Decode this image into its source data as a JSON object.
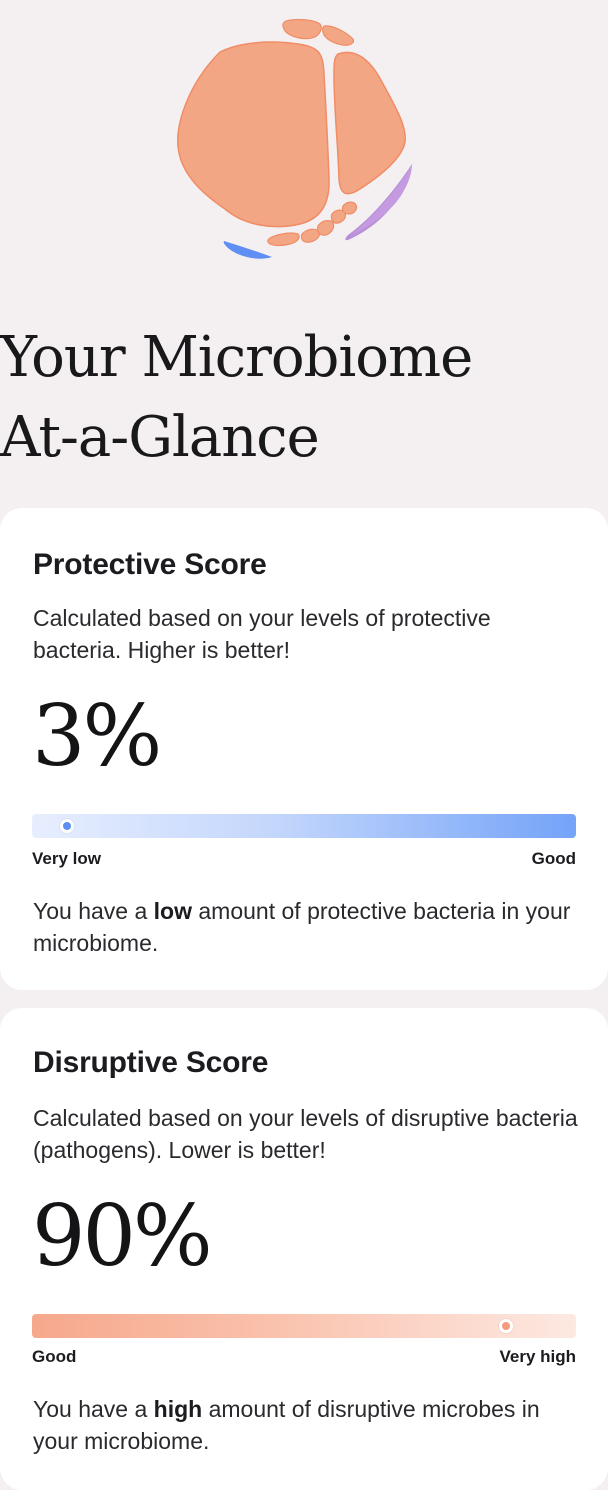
{
  "header": {
    "title_line1": "Your Microbiome",
    "title_line2": "At-a-Glance"
  },
  "illustration": {
    "icon": "microbiome-cells-illustration",
    "colors": {
      "cells": "#f3a684",
      "cells_stroke": "#f08c66",
      "purple": "#b88fd6",
      "blue": "#5f8ff2"
    }
  },
  "protective": {
    "title": "Protective Score",
    "description": "Calculated based on your levels of protective bacteria. Higher is better!",
    "score": "3%",
    "level": 0.03,
    "scale_low_label": "Very low",
    "scale_high_label": "Good",
    "summary_prefix": "You have a ",
    "summary_emphasis": "low",
    "summary_suffix": " amount of protective bacteria in your microbiome.",
    "colors": {
      "marker": "#5b8ef0",
      "bar_end": "#74a3f8"
    }
  },
  "disruptive": {
    "title": "Disruptive Score",
    "description": "Calculated based on your levels of disruptive bacteria (pathogens). Lower is better!",
    "score": "90%",
    "level": 0.9,
    "scale_low_label": "Good",
    "scale_high_label": "Very high",
    "summary_prefix": "You have a ",
    "summary_emphasis": "high",
    "summary_suffix": " amount of disruptive microbes in your microbiome.",
    "colors": {
      "marker": "#f59a7c",
      "bar_start": "#f6a88c"
    }
  }
}
